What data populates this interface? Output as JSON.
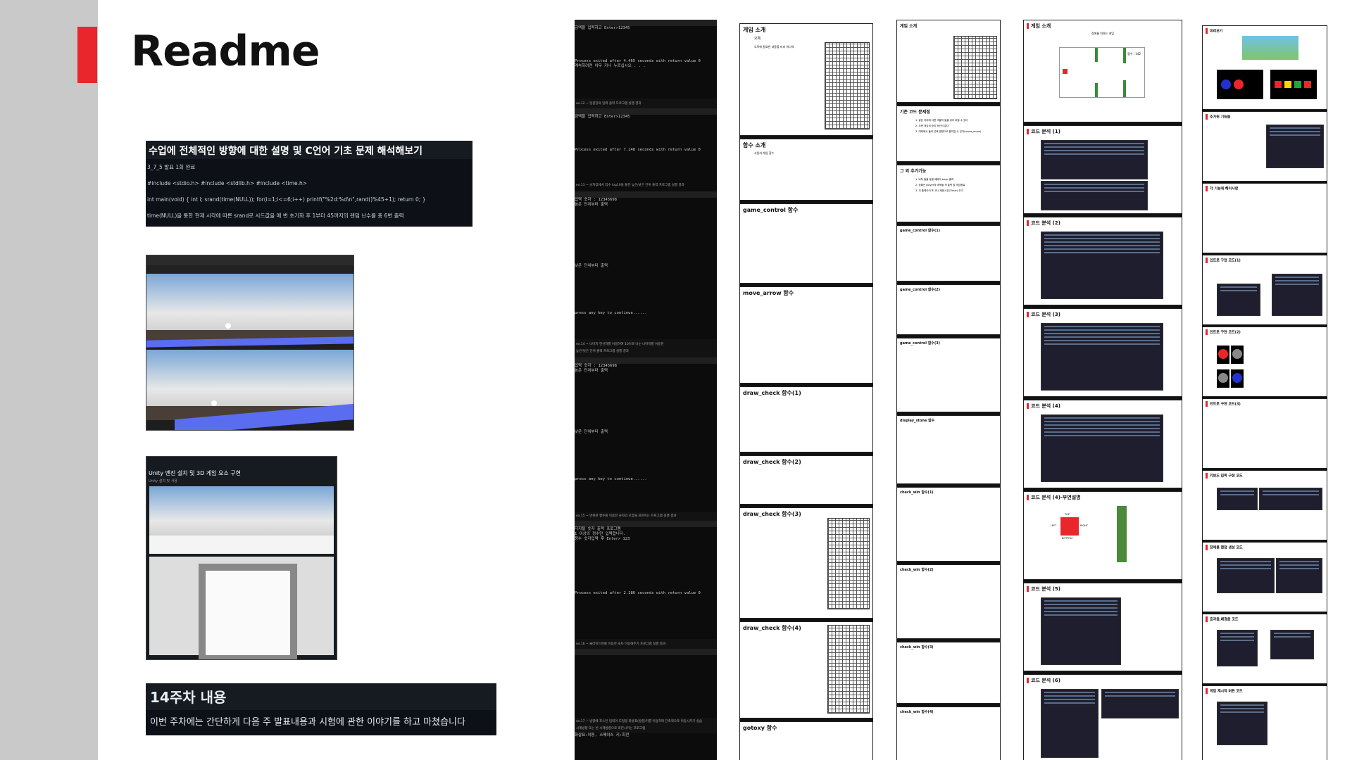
{
  "title": "Readme",
  "card1": {
    "heading": "수업에 전체적인 방향에 대한 설명 및 C언어 기초 문제 해석해보기",
    "lines": [
      "3_7_5 발표 1회 완료",
      "#include <stdio.h> #include <stdlib.h> #include <time.h>",
      "int main(void) { int i; srand(time(NULL)); for(i=1;i<=6;i++) printf(\"%2d:%d\\n\",rand()%45+1); return 0; }",
      "time(NULL)을 통한 현재 시각에 따른 srand로 시드값을 매 번 초기화 후 1부터 45까지의 랜덤 난수를 총 6번 출력"
    ]
  },
  "unity_card": {
    "heading": "Unity 엔진 설치 및 3D 게임 요소 구현",
    "sub": "Unity 설치 및 사용"
  },
  "card14": {
    "heading": "14주차 내용",
    "body": "이번 주차에는 간단하게 다음 주 발표내용과 시험에 관한 이야기를 하고 마쳤습니다"
  },
  "terminals": {
    "t1_prompt": "금액을 입력하고 Enter>12345",
    "t1_exit": "Process exited after 4.465 seconds with return value 0",
    "t1_press": "계속하려면 아무 키나 누르십시오 . . .",
    "cap1": "ex.12 ~ 달걀장의 입력 출력 프로그램 실행 결과",
    "t2_prompt": "금액을 입력하고 Enter>12345",
    "t2_exit": "Process exited after 7.148 seconds with return value 0",
    "cap2": "ex.13 ~ 숫자값에서 함수 log10을 통한 높은/낮은 단위 출력 프로그램 실행 결과",
    "t3_num": "입력 숫자 : 12345698",
    "t3_high": "높은 단위부터 출력",
    "t3_low": "낮은 단위부터 출력",
    "t3_press": "press any key to continue......",
    "cap3": "ex.14 ~ 나머지 연산자를 이용하여 10으로 나눈 나머지를 이용한",
    "cap3b": "높은/낮은 단위 출력 프로그램 실행 결과",
    "t4_num": "입력 숫자 : 12345698",
    "t4_high": "높은 단위부터 출력",
    "t4_low": "낮은 단위부터 출력",
    "t4_press": "press any key to continue......",
    "cap4": "ex.15 ~ 반복된 행수를 이용한 숫자의 모양을 표현하는 프로그램 실행 결과",
    "t5_l1": "디지털 숫자 출력 프로그램",
    "t5_l2": "1 이상의 정수만 입력합니다.",
    "t5_l3": "정수 숫자입력 후 Enter> 123",
    "t5_exit": "Process exited after 2.186 seconds with return value 0",
    "cap5": "ex.16 ~ 슬라이드바를 이용한 숫자 이동해주기 프로그램 실행 결과",
    "cap6": "ex.17 ~ 방향에 포스된 입력이 도형을 화살표(방향)키를 이용하여 단축적으로 이동시키기 실습",
    "cap6b": "시계방향 또는 반 시계방향으로 회전시키는 프로그램",
    "t6_l1": "화살표:이동, 스페이스 키:회전"
  },
  "slides_b": [
    "게임 소개",
    "함수 소개",
    "game_control 함수",
    "move_arrow 함수",
    "draw_check 함수(1)",
    "draw_check 함수(2)",
    "draw_check 함수(3)",
    "draw_check 함수(4)",
    "gotoxy 함수"
  ],
  "slides_b_sub": {
    "intro": "오목",
    "intro2": "오목에 필요한 내용을 미리 하나씩",
    "func": "사용자 게임 함수"
  },
  "slides_c": [
    "게임 소개",
    "기존 코드 문제점",
    "그 외 추가기능",
    "game_control 함수(1)",
    "game_control 함수(2)",
    "game_control 함수(3)",
    "display_stone 함수",
    "check_win 함수(1)",
    "check_win 함수(2)",
    "check_win 함수(3)",
    "check_win 함수(4)"
  ],
  "slides_c_points": {
    "p1": "1. 같은 자리에 다른 색깔의 돌을 넣어 버릴 수 있다",
    "p2": "2. 오목 게임의 승리 조건이 없다",
    "p3": "3. 미래에서 돌의 선택 방향으로 움직일 수 있다(move_arrow)",
    "a1": "1. 바둑 돌을 놓을 때마다 beep 출력",
    "a2": "2. 승패는 player의 바둑돌 색 출력 및 게임종료",
    "a3": "3. 각 플레이어 포 코너 제한시간(Timer) 추가"
  },
  "slides_d": [
    "게임 소개",
    "코드 분석 (1)",
    "코드 분석 (2)",
    "코드 분석 (3)",
    "코드 분석 (4)",
    "코드 분석 (4)-부연설명",
    "코드 분석 (5)",
    "코드 분석 (6)"
  ],
  "slides_d_sub": {
    "game": "장애물 피하는 게임",
    "score": "점수 : 142",
    "top": "TOP",
    "bottom": "BOTTOM",
    "left": "LEFT",
    "right": "RIGHT"
  },
  "slides_e": [
    "미리보기",
    "추가된 기능들",
    "각 기능에 해이사항",
    "인트로 구현 코드(1)",
    "인트로 구현 코드(2)",
    "인트로 구현 코드(3)",
    "키보드 입력 구현 코드",
    "장애물 랜덤 생성 코드",
    "효과음,배경음 코드",
    "게임 재시작 버튼 코드"
  ],
  "colors": {
    "accent": "#e8262b",
    "sidebar": "#c9c9c9",
    "dark": "#0d1117"
  }
}
